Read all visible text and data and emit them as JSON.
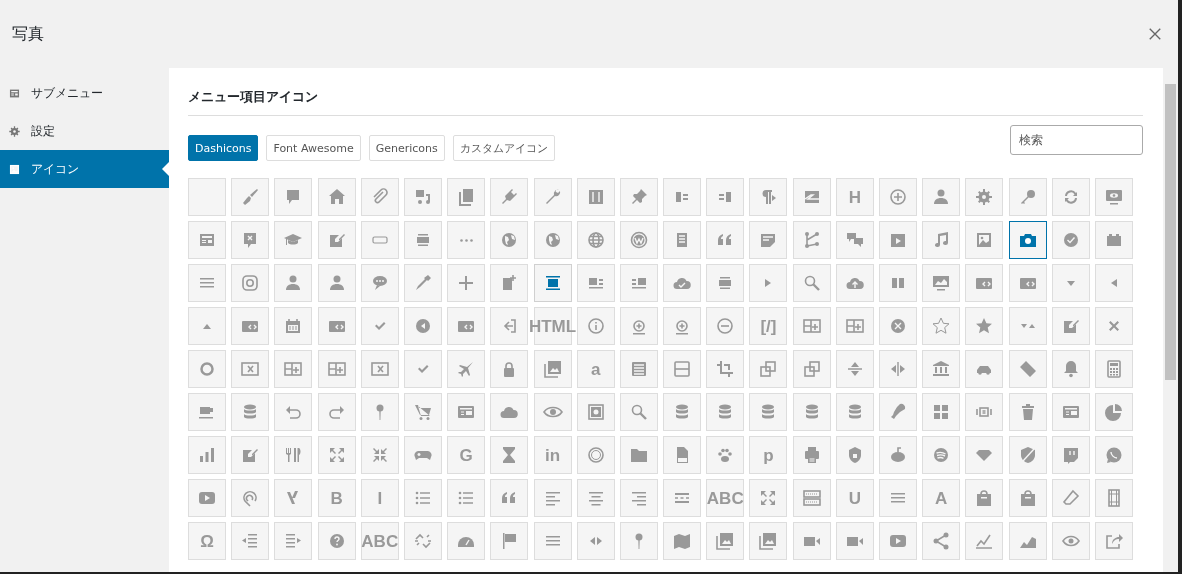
{
  "window": {
    "title": "写真"
  },
  "sidebar": {
    "items": [
      {
        "label": "サブメニュー",
        "kind": "form-table",
        "selected": false
      },
      {
        "label": "設定",
        "kind": "gear",
        "selected": false
      },
      {
        "label": "アイコン",
        "kind": "image",
        "selected": true
      }
    ]
  },
  "section_title": "メニュー項目アイコン",
  "tabs": [
    {
      "label": "Dashicons",
      "selected": true
    },
    {
      "label": "Font Awesome",
      "selected": false
    },
    {
      "label": "Genericons",
      "selected": false
    },
    {
      "label": "カスタムアイコン",
      "selected": false
    }
  ],
  "search": {
    "placeholder": "検索"
  },
  "icon_grid": [
    [
      {
        "kind": "blank",
        "selected": false,
        "hovered": false
      },
      {
        "kind": "paintbrush",
        "selected": false,
        "hovered": false
      },
      {
        "kind": "speech-bubble",
        "selected": false,
        "hovered": false
      },
      {
        "kind": "house",
        "selected": false,
        "hovered": false
      },
      {
        "kind": "paperclip",
        "selected": false,
        "hovered": false
      },
      {
        "kind": "music-files",
        "selected": false,
        "hovered": false
      },
      {
        "kind": "pages",
        "selected": false,
        "hovered": false
      },
      {
        "kind": "plug",
        "selected": false,
        "hovered": false
      },
      {
        "kind": "wrench",
        "selected": false,
        "hovered": false
      },
      {
        "kind": "sliders",
        "selected": false,
        "hovered": false
      },
      {
        "kind": "pushpin",
        "selected": false,
        "hovered": false
      },
      {
        "kind": "block-left",
        "selected": false,
        "hovered": false
      },
      {
        "kind": "block-right",
        "selected": false,
        "hovered": false
      },
      {
        "kind": "paragraph",
        "selected": false,
        "hovered": false
      },
      {
        "kind": "zigzag-box",
        "selected": false,
        "hovered": false
      },
      {
        "kind": "letter",
        "glyph": "H",
        "selected": false,
        "hovered": false
      },
      {
        "kind": "plus-circle",
        "selected": false,
        "hovered": false
      },
      {
        "kind": "person",
        "selected": false,
        "hovered": false
      },
      {
        "kind": "gear",
        "selected": false,
        "hovered": false
      },
      {
        "kind": "key",
        "selected": false,
        "hovered": false
      },
      {
        "kind": "sync-arrows",
        "selected": false,
        "hovered": false
      },
      {
        "kind": "monitor-eye",
        "selected": false,
        "hovered": false
      }
    ],
    [
      {
        "kind": "form-table",
        "selected": false,
        "hovered": false
      },
      {
        "kind": "bubble-x",
        "selected": false,
        "hovered": false
      },
      {
        "kind": "graduation-cap",
        "selected": false,
        "hovered": false
      },
      {
        "kind": "edit-page",
        "selected": false,
        "hovered": false
      },
      {
        "kind": "rounded-rectangle",
        "selected": false,
        "hovered": false
      },
      {
        "kind": "stacked-bars",
        "selected": false,
        "hovered": false
      },
      {
        "kind": "ellipsis",
        "selected": false,
        "hovered": false
      },
      {
        "kind": "globe",
        "selected": false,
        "hovered": false
      },
      {
        "kind": "globe",
        "selected": false,
        "hovered": false
      },
      {
        "kind": "wire-globe",
        "selected": false,
        "hovered": false
      },
      {
        "kind": "circle-emblem",
        "selected": false,
        "hovered": false
      },
      {
        "kind": "document",
        "selected": false,
        "hovered": false
      },
      {
        "kind": "quote",
        "selected": false,
        "hovered": false
      },
      {
        "kind": "sticky-note",
        "selected": false,
        "hovered": false
      },
      {
        "kind": "node-graph",
        "selected": false,
        "hovered": false
      },
      {
        "kind": "chat-bubbles",
        "selected": false,
        "hovered": false
      },
      {
        "kind": "film-play",
        "selected": false,
        "hovered": false
      },
      {
        "kind": "music-note",
        "selected": false,
        "hovered": false
      },
      {
        "kind": "image",
        "selected": false,
        "hovered": false
      },
      {
        "kind": "camera",
        "selected": true,
        "hovered": false
      },
      {
        "kind": "check-circle",
        "selected": false,
        "hovered": false
      },
      {
        "kind": "box",
        "selected": false,
        "hovered": false
      }
    ],
    [
      {
        "kind": "list-lines",
        "selected": false,
        "hovered": false
      },
      {
        "kind": "rounded-camera",
        "selected": false,
        "hovered": false
      },
      {
        "kind": "person",
        "selected": false,
        "hovered": false
      },
      {
        "kind": "person",
        "selected": false,
        "hovered": false
      },
      {
        "kind": "chat-dots",
        "selected": false,
        "hovered": false
      },
      {
        "kind": "eyedropper",
        "selected": false,
        "hovered": false
      },
      {
        "kind": "plus",
        "selected": false,
        "hovered": false
      },
      {
        "kind": "page-plus",
        "selected": false,
        "hovered": false
      },
      {
        "kind": "align-full",
        "selected": false,
        "hovered": true
      },
      {
        "kind": "media-text",
        "selected": false,
        "hovered": false
      },
      {
        "kind": "media-text-right",
        "selected": false,
        "hovered": false
      },
      {
        "kind": "cloud-check",
        "selected": false,
        "hovered": false
      },
      {
        "kind": "stacked-bars",
        "selected": false,
        "hovered": false
      },
      {
        "kind": "caret-right",
        "selected": false,
        "hovered": false
      },
      {
        "kind": "magnifier",
        "selected": false,
        "hovered": false
      },
      {
        "kind": "cloud-upload",
        "selected": false,
        "hovered": false
      },
      {
        "kind": "two-columns",
        "selected": false,
        "hovered": false
      },
      {
        "kind": "screen-chart",
        "selected": false,
        "hovered": false
      },
      {
        "kind": "embed",
        "selected": false,
        "hovered": false
      },
      {
        "kind": "embed",
        "selected": false,
        "hovered": false
      },
      {
        "kind": "caret-down",
        "selected": false,
        "hovered": false
      },
      {
        "kind": "caret-left",
        "selected": false,
        "hovered": false
      }
    ],
    [
      {
        "kind": "caret-up",
        "selected": false,
        "hovered": false
      },
      {
        "kind": "embed",
        "selected": false,
        "hovered": false
      },
      {
        "kind": "calendar",
        "selected": false,
        "hovered": false
      },
      {
        "kind": "embed",
        "selected": false,
        "hovered": false
      },
      {
        "kind": "check",
        "selected": false,
        "hovered": false
      },
      {
        "kind": "circle-arrow",
        "selected": false,
        "hovered": false
      },
      {
        "kind": "embed",
        "selected": false,
        "hovered": false
      },
      {
        "kind": "exit-arrow",
        "selected": false,
        "hovered": false
      },
      {
        "kind": "letter",
        "glyph": "HTML",
        "selected": false,
        "hovered": false
      },
      {
        "kind": "info-circle",
        "selected": false,
        "hovered": false
      },
      {
        "kind": "plus-circle-bar",
        "selected": false,
        "hovered": false
      },
      {
        "kind": "plus-circle-bar",
        "selected": false,
        "hovered": false
      },
      {
        "kind": "minus-circle",
        "selected": false,
        "hovered": false
      },
      {
        "kind": "letter",
        "glyph": "[/]",
        "selected": false,
        "hovered": false
      },
      {
        "kind": "table-plus",
        "selected": false,
        "hovered": false
      },
      {
        "kind": "table-plus",
        "selected": false,
        "hovered": false
      },
      {
        "kind": "x-circle",
        "selected": false,
        "hovered": false
      },
      {
        "kind": "star-outline",
        "selected": false,
        "hovered": false
      },
      {
        "kind": "star",
        "selected": false,
        "hovered": false
      },
      {
        "kind": "sort-triangles",
        "selected": false,
        "hovered": false
      },
      {
        "kind": "edit-page",
        "selected": false,
        "hovered": false
      },
      {
        "kind": "close-x",
        "selected": false,
        "hovered": false
      }
    ],
    [
      {
        "kind": "ring",
        "selected": false,
        "hovered": false
      },
      {
        "kind": "table-x",
        "selected": false,
        "hovered": false
      },
      {
        "kind": "table-plus",
        "selected": false,
        "hovered": false
      },
      {
        "kind": "table-plus",
        "selected": false,
        "hovered": false
      },
      {
        "kind": "table-x",
        "selected": false,
        "hovered": false
      },
      {
        "kind": "check",
        "selected": false,
        "hovered": false
      },
      {
        "kind": "airplane",
        "selected": false,
        "hovered": false
      },
      {
        "kind": "lock",
        "selected": false,
        "hovered": false
      },
      {
        "kind": "images",
        "selected": false,
        "hovered": false
      },
      {
        "kind": "letter",
        "glyph": "a",
        "selected": false,
        "hovered": false
      },
      {
        "kind": "list-view",
        "selected": false,
        "hovered": false
      },
      {
        "kind": "split-panel",
        "selected": false,
        "hovered": false
      },
      {
        "kind": "crop",
        "selected": false,
        "hovered": false
      },
      {
        "kind": "overlapping-squares",
        "selected": false,
        "hovered": false
      },
      {
        "kind": "overlapping-squares",
        "selected": false,
        "hovered": false
      },
      {
        "kind": "flip-vertical",
        "selected": false,
        "hovered": false
      },
      {
        "kind": "flip-horizontal",
        "selected": false,
        "hovered": false
      },
      {
        "kind": "bank",
        "selected": false,
        "hovered": false
      },
      {
        "kind": "car",
        "selected": false,
        "hovered": false
      },
      {
        "kind": "tickets",
        "selected": false,
        "hovered": false
      },
      {
        "kind": "bell",
        "selected": false,
        "hovered": false
      },
      {
        "kind": "calculator",
        "selected": false,
        "hovered": false
      }
    ],
    [
      {
        "kind": "cup",
        "selected": false,
        "hovered": false
      },
      {
        "kind": "database",
        "selected": false,
        "hovered": false
      },
      {
        "kind": "undo",
        "selected": false,
        "hovered": false
      },
      {
        "kind": "redo",
        "selected": false,
        "hovered": false
      },
      {
        "kind": "map-pin",
        "selected": false,
        "hovered": false
      },
      {
        "kind": "cart",
        "selected": false,
        "hovered": false
      },
      {
        "kind": "id-card",
        "selected": false,
        "hovered": false
      },
      {
        "kind": "cloud",
        "selected": false,
        "hovered": false
      },
      {
        "kind": "eye",
        "selected": false,
        "hovered": false
      },
      {
        "kind": "safe",
        "selected": false,
        "hovered": false
      },
      {
        "kind": "magnifier",
        "selected": false,
        "hovered": false
      },
      {
        "kind": "database",
        "selected": false,
        "hovered": false
      },
      {
        "kind": "database",
        "selected": false,
        "hovered": false
      },
      {
        "kind": "database",
        "selected": false,
        "hovered": false
      },
      {
        "kind": "database",
        "selected": false,
        "hovered": false
      },
      {
        "kind": "database",
        "selected": false,
        "hovered": false
      },
      {
        "kind": "drumstick",
        "selected": false,
        "hovered": false
      },
      {
        "kind": "grid",
        "selected": false,
        "hovered": false
      },
      {
        "kind": "slides",
        "selected": false,
        "hovered": false
      },
      {
        "kind": "trash",
        "selected": false,
        "hovered": false
      },
      {
        "kind": "id-card",
        "selected": false,
        "hovered": false
      },
      {
        "kind": "pie",
        "selected": false,
        "hovered": false
      }
    ],
    [
      {
        "kind": "bar-chart",
        "selected": false,
        "hovered": false
      },
      {
        "kind": "edit-page",
        "selected": false,
        "hovered": false
      },
      {
        "kind": "cutlery",
        "selected": false,
        "hovered": false
      },
      {
        "kind": "expand",
        "selected": false,
        "hovered": false
      },
      {
        "kind": "collapse",
        "selected": false,
        "hovered": false
      },
      {
        "kind": "gamepad",
        "selected": false,
        "hovered": false
      },
      {
        "kind": "letter",
        "glyph": "G",
        "selected": false,
        "hovered": false
      },
      {
        "kind": "hourglass",
        "selected": false,
        "hovered": false
      },
      {
        "kind": "letter",
        "glyph": "in",
        "selected": false,
        "hovered": false
      },
      {
        "kind": "coin",
        "selected": false,
        "hovered": false
      },
      {
        "kind": "folder",
        "selected": false,
        "hovered": false
      },
      {
        "kind": "file",
        "selected": false,
        "hovered": false
      },
      {
        "kind": "paw",
        "selected": false,
        "hovered": false
      },
      {
        "kind": "letter",
        "glyph": "p",
        "selected": false,
        "hovered": false
      },
      {
        "kind": "printer",
        "selected": false,
        "hovered": false
      },
      {
        "kind": "lock-badge",
        "selected": false,
        "hovered": false
      },
      {
        "kind": "antenna-head",
        "selected": false,
        "hovered": false
      },
      {
        "kind": "striped-circle",
        "selected": false,
        "hovered": false
      },
      {
        "kind": "diamond",
        "selected": false,
        "hovered": false
      },
      {
        "kind": "shield-slash",
        "selected": false,
        "hovered": false
      },
      {
        "kind": "tv-bubble",
        "selected": false,
        "hovered": false
      },
      {
        "kind": "phone-bubble",
        "selected": false,
        "hovered": false
      }
    ],
    [
      {
        "kind": "play-box",
        "selected": false,
        "hovered": false
      },
      {
        "kind": "loop-pin",
        "selected": false,
        "hovered": false
      },
      {
        "kind": "cross-strokes",
        "selected": false,
        "hovered": false
      },
      {
        "kind": "letter",
        "glyph": "B",
        "selected": false,
        "hovered": false
      },
      {
        "kind": "letter",
        "glyph": "I",
        "selected": false,
        "hovered": false
      },
      {
        "kind": "bullet-list",
        "selected": false,
        "hovered": false
      },
      {
        "kind": "bullet-list",
        "selected": false,
        "hovered": false
      },
      {
        "kind": "quote",
        "selected": false,
        "hovered": false
      },
      {
        "kind": "align-left",
        "selected": false,
        "hovered": false
      },
      {
        "kind": "align-center",
        "selected": false,
        "hovered": false
      },
      {
        "kind": "align-right",
        "selected": false,
        "hovered": false
      },
      {
        "kind": "dashed-lines",
        "selected": false,
        "hovered": false
      },
      {
        "kind": "letter",
        "glyph": "ABC",
        "selected": false,
        "hovered": false
      },
      {
        "kind": "expand",
        "selected": false,
        "hovered": false
      },
      {
        "kind": "keyboard",
        "selected": false,
        "hovered": false
      },
      {
        "kind": "letter",
        "glyph": "U",
        "selected": false,
        "hovered": false
      },
      {
        "kind": "list-lines",
        "selected": false,
        "hovered": false
      },
      {
        "kind": "letter",
        "glyph": "A",
        "selected": false,
        "hovered": false
      },
      {
        "kind": "bag",
        "selected": false,
        "hovered": false
      },
      {
        "kind": "bag",
        "selected": false,
        "hovered": false
      },
      {
        "kind": "eraser",
        "selected": false,
        "hovered": false
      },
      {
        "kind": "film-strip",
        "selected": false,
        "hovered": false
      }
    ],
    [
      {
        "kind": "letter",
        "glyph": "Ω",
        "selected": false,
        "hovered": false
      },
      {
        "kind": "outdent",
        "selected": false,
        "hovered": false
      },
      {
        "kind": "indent",
        "selected": false,
        "hovered": false
      },
      {
        "kind": "help-circle",
        "selected": false,
        "hovered": false
      },
      {
        "kind": "letter",
        "glyph": "ABC",
        "selected": false,
        "hovered": false
      },
      {
        "kind": "broken-chain",
        "selected": false,
        "hovered": false
      },
      {
        "kind": "gauge",
        "selected": false,
        "hovered": false
      },
      {
        "kind": "flag",
        "selected": false,
        "hovered": false
      },
      {
        "kind": "list-lines",
        "selected": false,
        "hovered": false
      },
      {
        "kind": "left-right-arrows",
        "selected": false,
        "hovered": false
      },
      {
        "kind": "map-pin",
        "selected": false,
        "hovered": false
      },
      {
        "kind": "map",
        "selected": false,
        "hovered": false
      },
      {
        "kind": "images",
        "selected": false,
        "hovered": false
      },
      {
        "kind": "images",
        "selected": false,
        "hovered": false
      },
      {
        "kind": "video-camera",
        "selected": false,
        "hovered": false
      },
      {
        "kind": "video-camera",
        "selected": false,
        "hovered": false
      },
      {
        "kind": "play-box",
        "selected": false,
        "hovered": false
      },
      {
        "kind": "share",
        "selected": false,
        "hovered": false
      },
      {
        "kind": "line-chart",
        "selected": false,
        "hovered": false
      },
      {
        "kind": "area-chart",
        "selected": false,
        "hovered": false
      },
      {
        "kind": "eye-arrows",
        "selected": false,
        "hovered": false
      },
      {
        "kind": "share-box",
        "selected": false,
        "hovered": false
      }
    ]
  ]
}
